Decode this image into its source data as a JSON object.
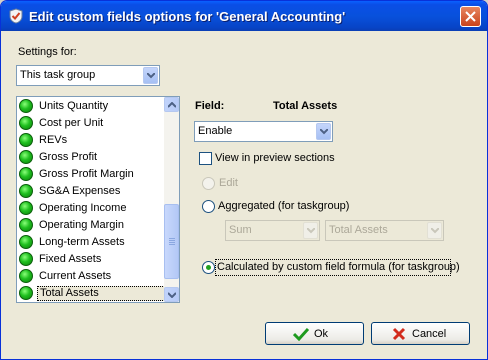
{
  "window": {
    "title": "Edit custom fields options for  'General Accounting'",
    "close_label": "close"
  },
  "settings_for": {
    "label": "Settings for:",
    "value": "This task group"
  },
  "fields_list": {
    "items": [
      "Units Quantity",
      "Cost per Unit",
      "REVs",
      "Gross Profit",
      "Gross Profit Margin",
      "SG&A Expenses",
      "Operating Income",
      "Operating Margin",
      "Long-term Assets",
      "Fixed Assets",
      "Current Assets",
      "Total Assets"
    ],
    "selected": "Total Assets",
    "status_color": "#1fbf1f"
  },
  "field_panel": {
    "field_label": "Field:",
    "field_name": "Total Assets",
    "mode_value": "Enable",
    "view_in_preview_label": "View in preview sections",
    "view_in_preview_checked": false,
    "edit_label": "Edit",
    "aggregated_label": "Aggregated (for taskgroup)",
    "agg_function": "Sum",
    "agg_field": "Total Assets",
    "calculated_label": "Calculated by custom field formula (for taskgroup)",
    "selected_option": "calculated"
  },
  "buttons": {
    "ok": "Ok",
    "cancel": "Cancel"
  },
  "icons": {
    "title": "checkmark-shield-icon",
    "ok": "green-check-icon",
    "cancel": "red-x-icon"
  }
}
